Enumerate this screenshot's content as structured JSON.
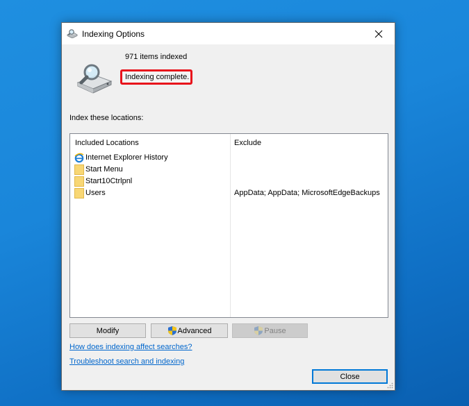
{
  "window": {
    "title": "Indexing Options",
    "close_glyph": "✕"
  },
  "status": {
    "items_indexed": "971 items indexed",
    "state": "Indexing complete."
  },
  "locations": {
    "heading": "Index these locations:",
    "columns": [
      "Included Locations",
      "Exclude"
    ],
    "rows": [
      {
        "icon": "internet-explorer-icon",
        "name": "Internet Explorer History",
        "exclude": ""
      },
      {
        "icon": "folder-icon",
        "name": "Start Menu",
        "exclude": ""
      },
      {
        "icon": "folder-icon",
        "name": "Start10Ctrlpnl",
        "exclude": ""
      },
      {
        "icon": "folder-icon",
        "name": "Users",
        "exclude": "AppData; AppData; MicrosoftEdgeBackups"
      }
    ]
  },
  "buttons": {
    "modify": "Modify",
    "advanced": "Advanced",
    "pause": "Pause",
    "close": "Close"
  },
  "links": {
    "how_affect": "How does indexing affect searches?",
    "troubleshoot": "Troubleshoot search and indexing"
  },
  "colors": {
    "highlight": "#e8121b",
    "link": "#0066cc",
    "accent": "#0078d7"
  }
}
